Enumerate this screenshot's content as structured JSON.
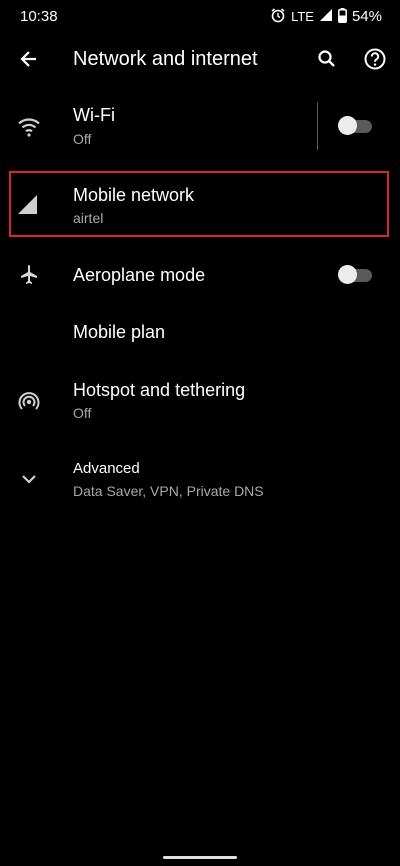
{
  "status_bar": {
    "time": "10:38",
    "network": "LTE",
    "battery": "54%",
    "icons": [
      "alarm-icon",
      "signal-icon",
      "battery-icon"
    ]
  },
  "app_bar": {
    "title": "Network and internet",
    "icons": [
      "back-arrow-icon",
      "search-icon",
      "help-icon"
    ]
  },
  "settings": {
    "wifi": {
      "title": "Wi-Fi",
      "subtitle": "Off",
      "icon": "wifi-icon",
      "toggle_on": false
    },
    "mobile": {
      "title": "Mobile network",
      "subtitle": "airtel",
      "icon": "signal-strength-icon",
      "highlighted": true
    },
    "aeroplane": {
      "title": "Aeroplane mode",
      "icon": "airplane-icon",
      "toggle_on": false
    },
    "plan": {
      "title": "Mobile plan"
    },
    "hotspot": {
      "title": "Hotspot and tethering",
      "subtitle": "Off",
      "icon": "hotspot-icon"
    },
    "advanced": {
      "title": "Advanced",
      "subtitle": "Data Saver, VPN, Private DNS",
      "icon": "chevron-down-icon"
    }
  },
  "colors": {
    "background": "#000000",
    "text_primary": "#ffffff",
    "text_secondary": "#a9a9a9",
    "highlight_border": "#d8262d",
    "toggle_track": "#5a5a5a",
    "toggle_thumb": "#ececec"
  }
}
